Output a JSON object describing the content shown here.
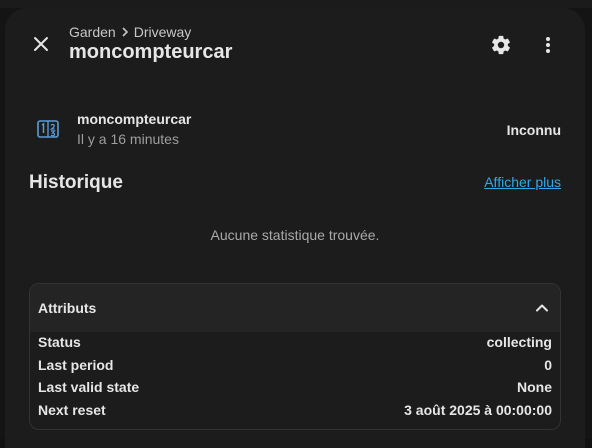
{
  "header": {
    "breadcrumb": [
      "Garden",
      "Driveway"
    ],
    "title": "moncompteurcar"
  },
  "icons": {
    "close": "close-icon",
    "settings": "gear-icon",
    "more": "dots-vertical-icon",
    "entity": "counter-icon",
    "collapse": "chevron-up-icon"
  },
  "entity": {
    "name": "moncompteurcar",
    "last_changed": "Il y a 16 minutes",
    "state": "Inconnu"
  },
  "history": {
    "title": "Historique",
    "show_more": "Afficher plus",
    "empty_message": "Aucune statistique trouvée."
  },
  "attributes": {
    "title": "Attributs",
    "rows": [
      {
        "key": "Status",
        "value": "collecting"
      },
      {
        "key": "Last period",
        "value": "0"
      },
      {
        "key": "Last valid state",
        "value": "None"
      },
      {
        "key": "Next reset",
        "value": "3 août 2025 à 00:00:00"
      }
    ]
  },
  "colors": {
    "background": "#1c1c1c",
    "text": "#e6e6e6",
    "secondary_text": "#9e9e9e",
    "link": "#2ea8e6",
    "icon": "#5a9bd5"
  }
}
